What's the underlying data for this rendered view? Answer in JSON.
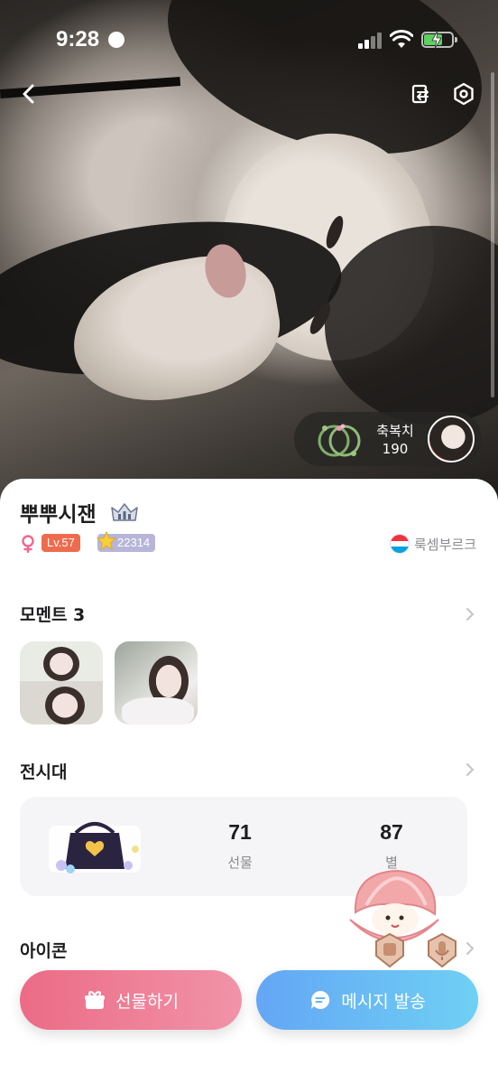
{
  "status_bar": {
    "time": "9:28"
  },
  "profile": {
    "name": "뿌뿌시잰",
    "level": "Lv.57",
    "stars": "22314",
    "country": "룩셈부르크",
    "blessing_label": "축복치",
    "blessing_value": "190"
  },
  "moments": {
    "title": "모멘트 3"
  },
  "showcase": {
    "title": "전시대",
    "gifts_value": "71",
    "gifts_label": "선물",
    "stars_value": "87",
    "stars_label": "별"
  },
  "icons_section": {
    "title": "아이콘"
  },
  "actions": {
    "gift_label": "선물하기",
    "message_label": "메시지 발송"
  },
  "colors": {
    "gift_button": "#ec6b86",
    "message_button": "#63a6f5",
    "level_badge": "#ee6b4d",
    "star_badge": "#b7b5d8"
  },
  "icons": [
    "back-icon",
    "share-icon",
    "settings-icon",
    "rings-icon",
    "crown-icon",
    "female-icon",
    "star-icon",
    "flag-luxembourg-icon",
    "chevron-right-icon",
    "gift-icon",
    "chat-icon"
  ]
}
